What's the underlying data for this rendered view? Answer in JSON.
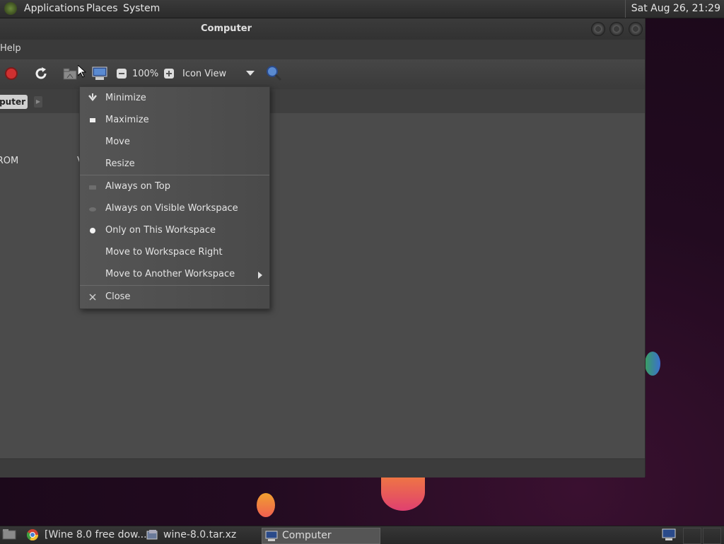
{
  "top_panel": {
    "menus": [
      "Applications",
      "Places",
      "System"
    ],
    "clock": "Sat Aug 26, 21:29"
  },
  "window": {
    "title": "Computer",
    "menubar": {
      "help": "Help"
    },
    "toolbar": {
      "zoom_level": "100%",
      "view_mode": "Icon View"
    },
    "pathbar": {
      "current": "Computer"
    },
    "content": {
      "items": [
        "CD-ROM",
        "V"
      ]
    }
  },
  "context_menu": {
    "items": [
      {
        "label": "Minimize",
        "icon": "minimize-icon"
      },
      {
        "label": "Maximize",
        "icon": "maximize-icon"
      },
      {
        "label": "Move",
        "icon": ""
      },
      {
        "label": "Resize",
        "icon": ""
      },
      {
        "label": "Always on Top",
        "icon": "checkbox-icon"
      },
      {
        "label": "Always on Visible Workspace",
        "icon": "radio-icon"
      },
      {
        "label": "Only on This Workspace",
        "icon": "radio-selected-icon"
      },
      {
        "label": "Move to Workspace Right",
        "icon": ""
      },
      {
        "label": "Move to Another Workspace",
        "icon": "submenu-arrow"
      },
      {
        "label": "Close",
        "icon": "close-icon"
      }
    ]
  },
  "taskbar": {
    "tasks": [
      {
        "label": "[Wine 8.0 free dow..."
      },
      {
        "label": "wine-8.0.tar.xz"
      },
      {
        "label": "Computer",
        "active": true
      }
    ]
  }
}
